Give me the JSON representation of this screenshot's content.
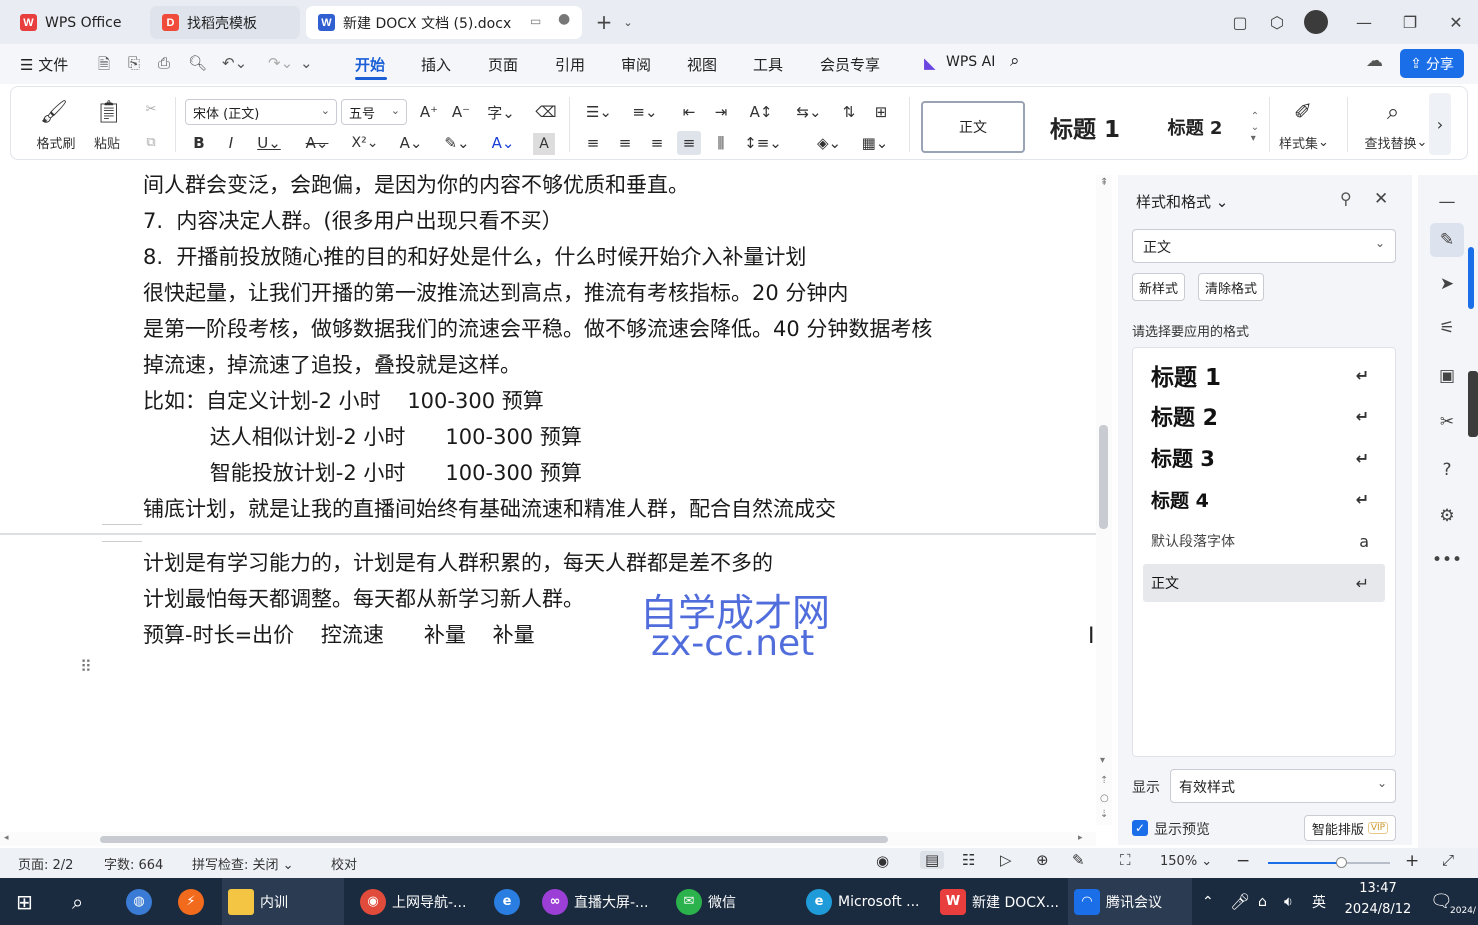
{
  "titlebar": {
    "tabs": [
      {
        "label": "WPS Office",
        "icon": "wps-logo-icon"
      },
      {
        "label": "找稻壳模板",
        "icon": "docer-icon"
      },
      {
        "label": "新建 DOCX 文档 (5).docx",
        "icon": "word-doc-icon",
        "active": true
      }
    ],
    "new_tab": "+"
  },
  "menu": {
    "file": "文件",
    "tabs": [
      "开始",
      "插入",
      "页面",
      "引用",
      "审阅",
      "视图",
      "工具",
      "会员专享"
    ],
    "active": "开始",
    "wps_ai": "WPS AI",
    "share": "分享"
  },
  "ribbon": {
    "format_painter": "格式刷",
    "paste": "粘贴",
    "font": "宋体 (正文)",
    "size": "五号",
    "styles": [
      "正文",
      "标题  1",
      "标题  2"
    ],
    "style_set": "样式集",
    "find_replace": "查找替换"
  },
  "document": {
    "lines": [
      "间人群会变泛，会跑偏，是因为你的内容不够优质和垂直。",
      "7.  内容决定人群。(很多用户出现只看不买）",
      "8.  开播前投放随心推的目的和好处是什么，什么时候开始介入补量计划",
      "很快起量，让我们开播的第一波推流达到高点，推流有考核指标。20 分钟内",
      "是第一阶段考核，做够数据我们的流速会平稳。做不够流速会降低。40 分钟数据考核",
      "掉流速，掉流速了追投，叠投就是这样。",
      "比如：自定义计划-2 小时    100-300 预算",
      "          达人相似计划-2 小时      100-300 预算",
      "          智能投放计划-2 小时      100-300 预算",
      "铺底计划，就是让我的直播间始终有基础流速和精准人群，配合自然流成交",
      "计划是有学习能力的，计划是有人群积累的，每天人群都是差不多的",
      "计划最怕每天都调整。每天都从新学习新人群。",
      "预算-时长=出价    控流速      补量    补量"
    ],
    "watermark_cn": "自学成才网",
    "watermark_en": "zx-cc.net"
  },
  "panel": {
    "title": "样式和格式",
    "current_style": "正文",
    "new_style": "新样式",
    "clear_format": "清除格式",
    "prompt": "请选择要应用的格式",
    "styles": [
      {
        "label": "标题  1",
        "mark": "↵"
      },
      {
        "label": "标题  2",
        "mark": "↵"
      },
      {
        "label": "标题  3",
        "mark": "↵"
      },
      {
        "label": "标题  4",
        "mark": "↵"
      },
      {
        "label": "默认段落字体",
        "mark": "a"
      },
      {
        "label": "正文",
        "mark": "↵"
      }
    ],
    "show_label": "显示",
    "show_value": "有效样式",
    "preview": "显示预览",
    "smart_layout": "智能排版",
    "vip": "VIP"
  },
  "status": {
    "page": "页面: 2/2",
    "words": "字数: 664",
    "spell": "拼写检查: 关闭",
    "proof": "校对",
    "zoom": "150%",
    "zoom_fraction": 0.6
  },
  "taskbar": {
    "items": [
      "内训",
      "上网导航-...",
      "直播大屏-...",
      "微信",
      "Microsoft ...",
      "新建 DOCX...",
      "腾讯会议"
    ],
    "ime": "英",
    "time": "13:47",
    "date": "2024/8/12",
    "year_badge": "2024/"
  }
}
